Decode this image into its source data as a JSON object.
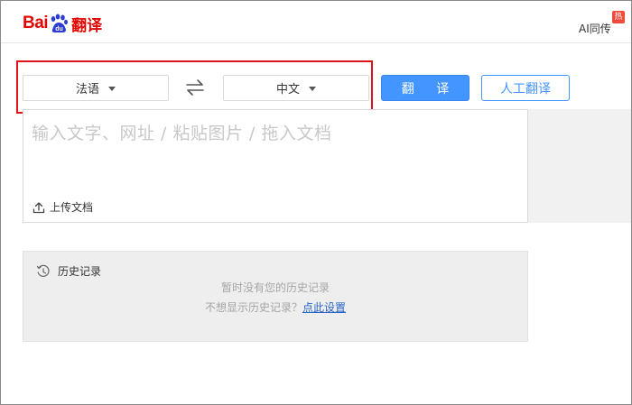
{
  "header": {
    "logo": {
      "bai": "Bai",
      "du": "du",
      "fanyi": "翻译"
    },
    "ai_link": "AI同传",
    "hot_badge": "热"
  },
  "languages": {
    "source": "法语",
    "target": "中文"
  },
  "buttons": {
    "translate": "翻 译",
    "human_translate": "人工翻译"
  },
  "input": {
    "placeholder": "输入文字、网址 / 粘贴图片 / 拖入文档",
    "upload_label": "上传文档"
  },
  "history": {
    "title": "历史记录",
    "empty_text": "暂时没有您的历史记录",
    "hide_prompt": "不想显示历史记录？",
    "settings_link": "点此设置"
  },
  "colors": {
    "brand_red": "#e10601",
    "accent_blue": "#4395ff",
    "highlight_red": "#e0131b"
  }
}
